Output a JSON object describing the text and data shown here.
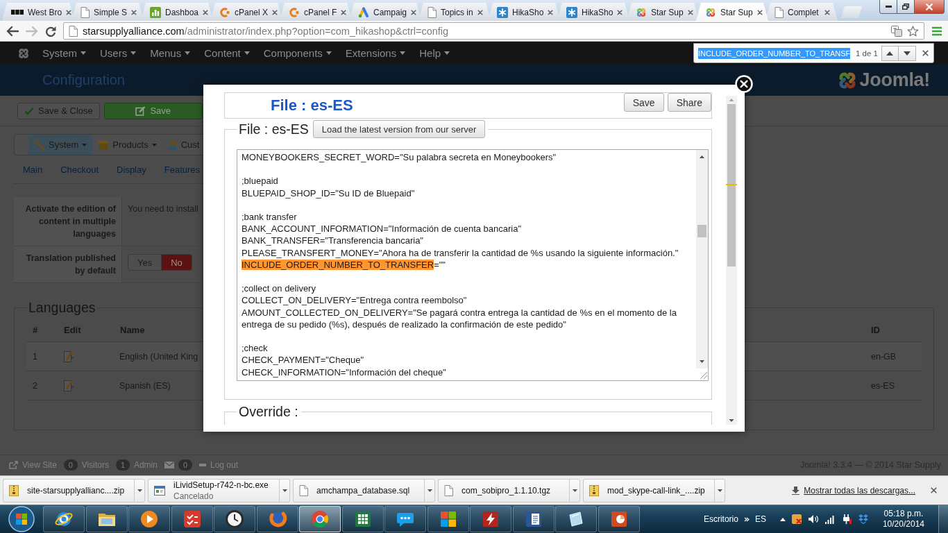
{
  "browser": {
    "tabs": [
      {
        "kind": "blocks",
        "title": "West Bro",
        "selected": false
      },
      {
        "kind": "page",
        "title": "Simple S",
        "selected": false
      },
      {
        "kind": "tile",
        "title": "Dashboa",
        "selected": false
      },
      {
        "kind": "arc",
        "title": "cPanel X",
        "selected": false
      },
      {
        "kind": "arc",
        "title": "cPanel F",
        "selected": false
      },
      {
        "kind": "triangle",
        "title": "Campaig",
        "selected": false
      },
      {
        "kind": "page",
        "title": "Topics in",
        "selected": false
      },
      {
        "kind": "asterisk",
        "title": "HikaSho",
        "selected": false
      },
      {
        "kind": "asterisk",
        "title": "HikaSho",
        "selected": false
      },
      {
        "kind": "knot",
        "title": "Star Sup",
        "selected": false
      },
      {
        "kind": "knot",
        "title": "Star Sup",
        "selected": true
      },
      {
        "kind": "page",
        "title": "Complet",
        "selected": false
      }
    ],
    "nav_buttons": [
      {
        "kind": "back",
        "disabled": false
      },
      {
        "kind": "forward",
        "disabled": true
      },
      {
        "kind": "reload",
        "disabled": false
      }
    ],
    "address": {
      "host": "starsupplyalliance.com",
      "path": "/administrator/index.php?option=com_hikashop&ctrl=config"
    }
  },
  "find_bar": {
    "query": "INCLUDE_ORDER_NUMBER_TO_TRANSF",
    "highlighted": true,
    "count": "1 de 1"
  },
  "admin": {
    "menu": [
      "System",
      "Users",
      "Menus",
      "Content",
      "Components",
      "Extensions",
      "Help"
    ],
    "page_title": "Configuration",
    "logo_text": "Joomla!",
    "toolbar": [
      {
        "kind": "check",
        "label": "Save & Close"
      },
      {
        "kind": "save",
        "label": "Save"
      }
    ],
    "shop_menu": [
      {
        "kind": "tools",
        "label": "System",
        "selected": true,
        "has_caret": true
      },
      {
        "kind": "box",
        "label": "Products",
        "selected": false,
        "has_caret": true
      },
      {
        "kind": "person",
        "label": "Cust",
        "selected": false,
        "has_caret": false
      }
    ],
    "config_tabs": [
      "Main",
      "Checkout",
      "Display",
      "Features"
    ],
    "settings": [
      {
        "kind": "text",
        "label": "Activate the edition of content in multiple languages",
        "value": "You need to install"
      },
      {
        "kind": "toggle",
        "label": "Translation published by default",
        "options": [
          {
            "label": "Yes",
            "selected": false
          },
          {
            "label": "No",
            "selected": true
          }
        ]
      }
    ],
    "languages": {
      "title": "Languages",
      "columns": [
        "#",
        "Edit",
        "Name",
        "ID"
      ],
      "rows": [
        {
          "number": "1",
          "name": "English (United King",
          "id": "en-GB"
        },
        {
          "number": "2",
          "name": "Spanish (ES)",
          "id": "es-ES"
        }
      ]
    },
    "footer": {
      "items": [
        {
          "kind": "link",
          "label": "View Site"
        },
        {
          "kind": "count",
          "count": "0",
          "label": "Visitors"
        },
        {
          "kind": "count",
          "count": "1",
          "label": "Admin"
        },
        {
          "kind": "mail",
          "count": "0"
        },
        {
          "kind": "logout",
          "label": "Log out"
        }
      ],
      "copyright": "Joomla! 3.3.4 — © 2014 Star Supply"
    }
  },
  "modal": {
    "title": "File : es-ES",
    "actions": [
      "Save",
      "Share"
    ],
    "file_section": {
      "legend": "File : es-ES",
      "load_button": "Load the latest version from our server",
      "blocks": [
        {
          "lines": [
            {
              "segments": [
                {
                  "text": "MONEYBOOKERS_SECRET_WORD=\"Su palabra secreta en Moneybookers\"",
                  "highlighted": false
                }
              ]
            }
          ]
        },
        {
          "lines": [
            {
              "segments": [
                {
                  "text": ";bluepaid",
                  "highlighted": false
                }
              ]
            },
            {
              "segments": [
                {
                  "text": "BLUEPAID_SHOP_ID=\"Su ID de Bluepaid\"",
                  "highlighted": false
                }
              ]
            }
          ]
        },
        {
          "lines": [
            {
              "segments": [
                {
                  "text": ";bank transfer",
                  "highlighted": false
                }
              ]
            },
            {
              "segments": [
                {
                  "text": "BANK_ACCOUNT_INFORMATION=\"Información de cuenta bancaria\"",
                  "highlighted": false
                }
              ]
            },
            {
              "segments": [
                {
                  "text": "BANK_TRANSFER=\"Transferencia bancaria\"",
                  "highlighted": false
                }
              ]
            },
            {
              "segments": [
                {
                  "text": "PLEASE_TRANSFERT_MONEY=\"Ahora ha de transferir la cantidad de %s usando la siguiente información.\"",
                  "highlighted": false
                }
              ]
            },
            {
              "segments": [
                {
                  "text": "INCLUDE_ORDER_NUMBER_TO_TRANSFER",
                  "highlighted": true
                },
                {
                  "text": "=\"\"",
                  "highlighted": false
                }
              ]
            }
          ]
        },
        {
          "lines": [
            {
              "segments": [
                {
                  "text": ";collect on delivery",
                  "highlighted": false
                }
              ]
            },
            {
              "segments": [
                {
                  "text": "COLLECT_ON_DELIVERY=\"Entrega contra reembolso\"",
                  "highlighted": false
                }
              ]
            },
            {
              "segments": [
                {
                  "text": "AMOUNT_COLLECTED_ON_DELIVERY=\"Se pagará contra entrega la cantidad de %s en el momento de la entrega de su pedido (%s), después de realizado la confirmación de este pedido\"",
                  "highlighted": false
                }
              ]
            }
          ]
        },
        {
          "lines": [
            {
              "segments": [
                {
                  "text": ";check",
                  "highlighted": false
                }
              ]
            },
            {
              "segments": [
                {
                  "text": "CHECK_PAYMENT=\"Cheque\"",
                  "highlighted": false
                }
              ]
            },
            {
              "segments": [
                {
                  "text": "CHECK_INFORMATION=\"Información del cheque\"",
                  "highlighted": false
                }
              ]
            }
          ]
        }
      ]
    },
    "override_legend": "Override :"
  },
  "downloads": {
    "items": [
      {
        "kind": "zip",
        "name": "site-starsupplyallianc....zip"
      },
      {
        "kind": "exe",
        "name": "iLividSetup-r742-n-bc.exe",
        "status": "Cancelado"
      },
      {
        "kind": "file",
        "name": "amchampa_database.sql"
      },
      {
        "kind": "file",
        "name": "com_sobipro_1.1.10.tgz"
      },
      {
        "kind": "zip",
        "name": "mod_skype-call-link_....zip"
      }
    ],
    "show_all": "Mostrar todas las descargas..."
  },
  "taskbar": {
    "apps": [
      {
        "kind": "globe",
        "selected": false
      },
      {
        "kind": "folder",
        "selected": false
      },
      {
        "kind": "player",
        "selected": false
      },
      {
        "kind": "stamp",
        "selected": false
      },
      {
        "kind": "clock",
        "selected": false
      },
      {
        "kind": "fox",
        "selected": false
      },
      {
        "kind": "chrome",
        "selected": true
      },
      {
        "kind": "sheet",
        "selected": false
      },
      {
        "kind": "chat",
        "selected": false
      },
      {
        "kind": "flag",
        "selected": false
      },
      {
        "kind": "zilla",
        "selected": false
      },
      {
        "kind": "doc",
        "selected": false
      },
      {
        "kind": "glass",
        "selected": false
      },
      {
        "kind": "slides",
        "selected": false
      }
    ],
    "desktop_label": "Escritorio",
    "language": "ES",
    "tray_icons": [
      {
        "kind": "shield"
      },
      {
        "kind": "speaker"
      },
      {
        "kind": "signal"
      },
      {
        "kind": "plug"
      },
      {
        "kind": "box"
      }
    ],
    "time": "05:18 p.m.",
    "date": "10/20/2014"
  }
}
